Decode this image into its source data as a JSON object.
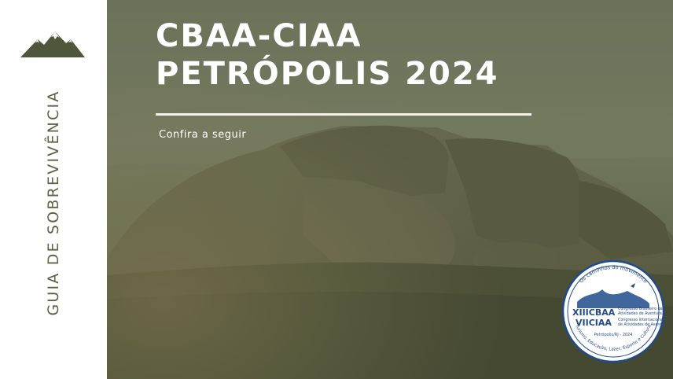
{
  "sidebar": {
    "logo_icon": "mountain-peaks-icon",
    "vertical_title": "GUIA DE SOBREVIVÊNCIA"
  },
  "hero": {
    "title_line1": "CBAA-CIAA",
    "title_line2": "PETRÓPOLIS 2024",
    "subtitle": "Confira a seguir"
  },
  "seal": {
    "arc_top": "Os caminhos do movimento",
    "line1_big": "XIIICBAA",
    "line1_small_a": "Congresso Brasileiro de",
    "line1_small_b": "Atividades de Aventura",
    "line2_big": "VIICIAA",
    "line2_small_a": "Congresso Internacional",
    "line2_small_b": "de Atividades de Aventura",
    "footer": "Petrópolis/RJ - 2024",
    "arc_bottom": "Turismo, Educação, Lazer, Esporte e Cultura"
  },
  "colors": {
    "olive": "#5c6243",
    "hero_overlay": "#5e6548",
    "seal_blue": "#1f4b8a"
  }
}
